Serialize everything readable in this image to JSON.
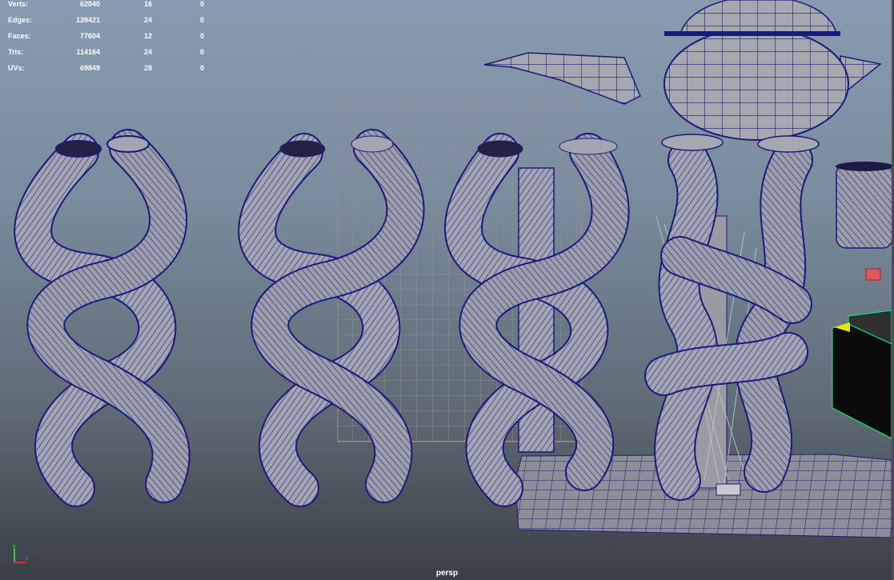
{
  "hud": {
    "rows": [
      {
        "label": "Verts:",
        "total": "62040",
        "selected": "16",
        "components": "0"
      },
      {
        "label": "Edges:",
        "total": "139421",
        "selected": "24",
        "components": "0"
      },
      {
        "label": "Faces:",
        "total": "77604",
        "selected": "12",
        "components": "0"
      },
      {
        "label": "Tris:",
        "total": "114164",
        "selected": "24",
        "components": "0"
      },
      {
        "label": "UVs:",
        "total": "69849",
        "selected": "28",
        "components": "0"
      }
    ]
  },
  "camera_label": "persp",
  "axis": {
    "y_label": "y",
    "x_label": "x"
  },
  "colors": {
    "wire": "#1a1a7a",
    "mesh_fill": "#a3a6b2",
    "grid": "#9a8c86",
    "floor": "#8c8f97",
    "axis_x": "#ff3030",
    "axis_y": "#30ff30",
    "axis_z": "#3030ff",
    "light_handle": "#e6e600"
  },
  "scene_objects": [
    "braid-mesh-1",
    "braid-mesh-2",
    "braid-mesh-3",
    "braid-mesh-4",
    "teapot-mesh",
    "floor-plane",
    "wire-grid",
    "camera-object"
  ]
}
